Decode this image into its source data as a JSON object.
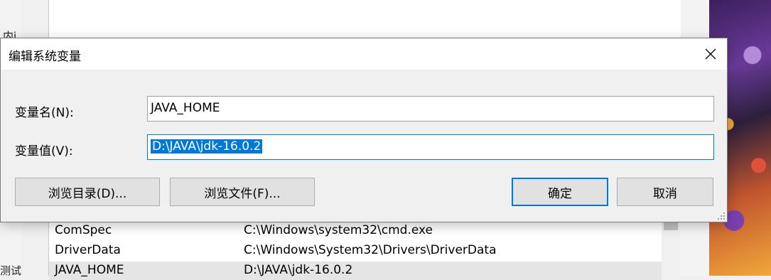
{
  "background": {
    "left_text_1": "内i",
    "left_text_2": "测试"
  },
  "variables_table": {
    "rows": [
      {
        "name": "ComSpec",
        "value": "C:\\Windows\\system32\\cmd.exe"
      },
      {
        "name": "DriverData",
        "value": "C:\\Windows\\System32\\Drivers\\DriverData"
      },
      {
        "name": "JAVA_HOME",
        "value": "D:\\JAVA\\jdk-16.0.2"
      }
    ]
  },
  "dialog": {
    "title": "编辑系统变量",
    "close_icon": "close-icon",
    "variable_name_label": "变量名(N):",
    "variable_name_value": "JAVA_HOME",
    "variable_value_label": "变量值(V):",
    "variable_value_value": "D:\\JAVA\\jdk-16.0.2",
    "browse_directory_label": "浏览目录(D)...",
    "browse_file_label": "浏览文件(F)...",
    "ok_label": "确定",
    "cancel_label": "取消"
  },
  "colors": {
    "accent": "#0078d7",
    "selection_text": "#ffffff"
  }
}
